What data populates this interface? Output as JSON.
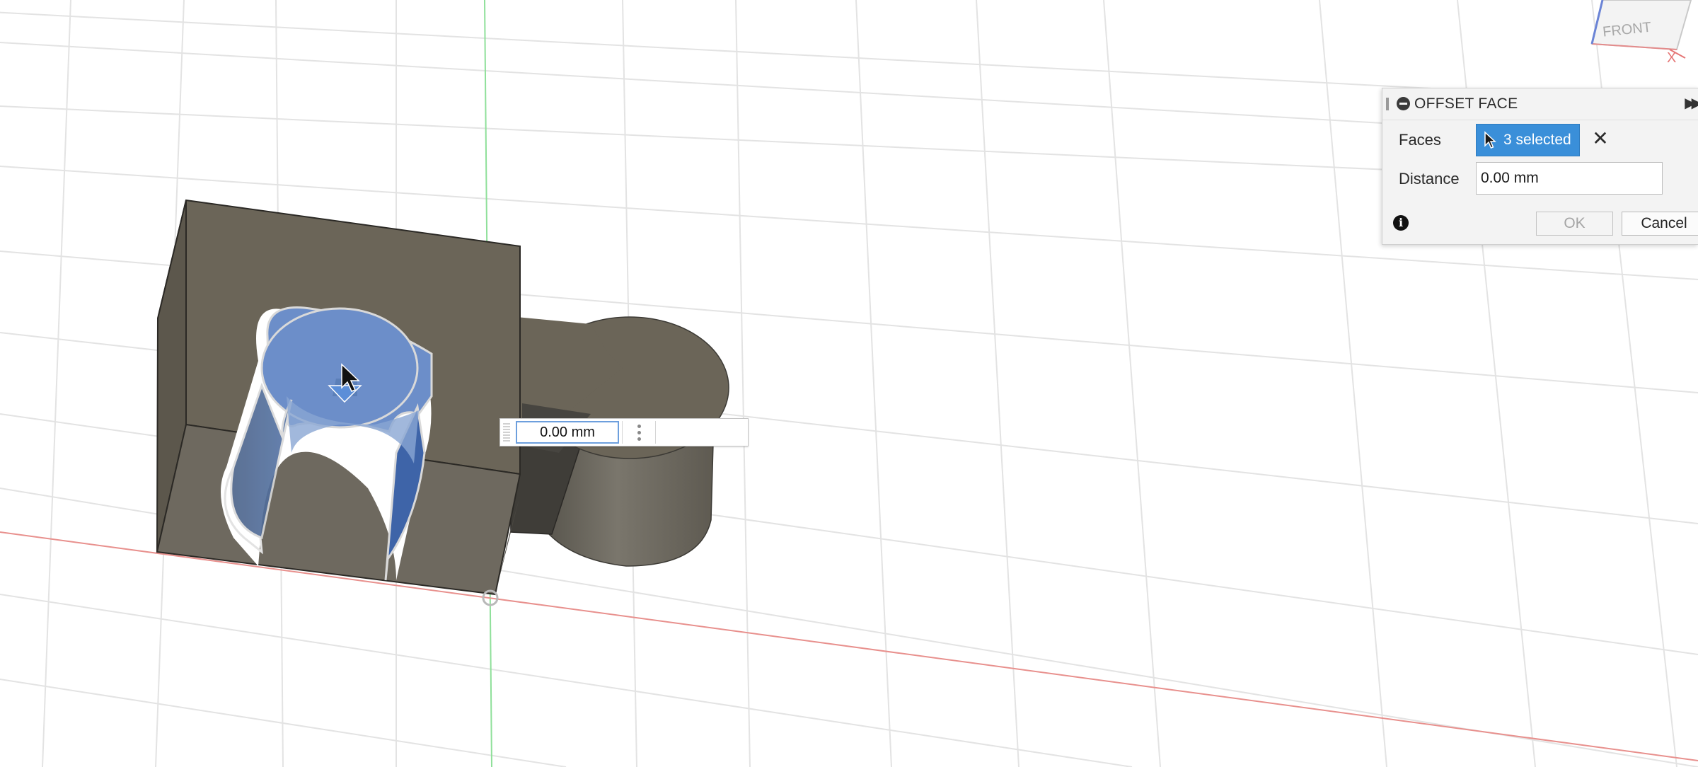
{
  "viewcube": {
    "face_label": "FRONT",
    "axis_label": "X"
  },
  "inline_editor": {
    "value": "0.00 mm"
  },
  "dialog": {
    "title": "OFFSET FACE",
    "faces_label": "Faces",
    "faces_selection": "3 selected",
    "distance_label": "Distance",
    "distance_value": "0.00 mm",
    "ok_label": "OK",
    "cancel_label": "Cancel"
  },
  "icons": {
    "collapse": "collapse-icon",
    "expand": "double-chevron-right-icon",
    "selection_cursor": "pointer-icon",
    "clear": "close-icon",
    "info": "info-icon"
  },
  "colors": {
    "selection_blue": "#3a8fd9",
    "selected_face_blue": "#6c8ec9",
    "model_body": "#6b6558",
    "x_axis": "#e37b78",
    "y_axis": "#8fe09a"
  }
}
